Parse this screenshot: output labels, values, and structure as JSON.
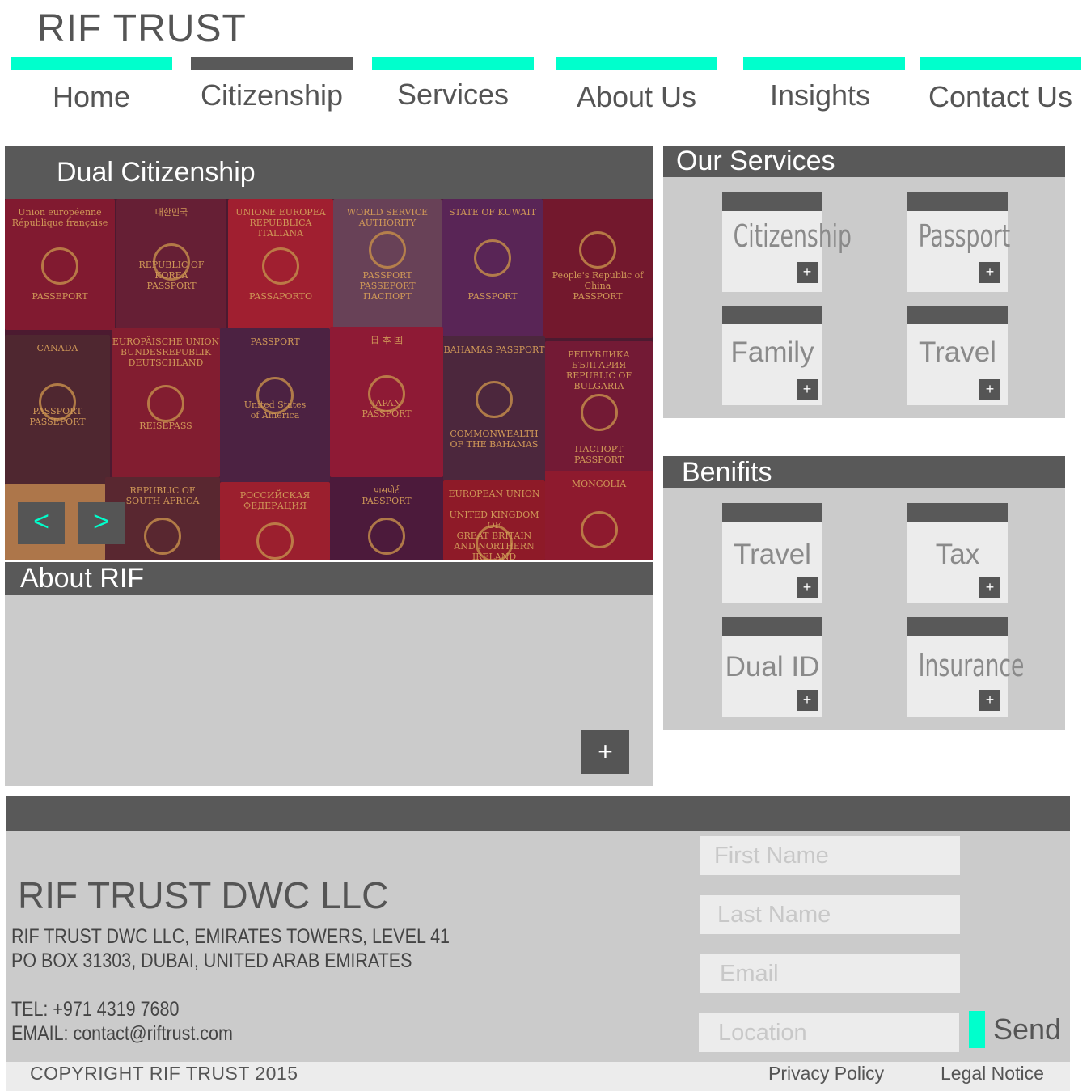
{
  "brand": {
    "logo": "RIF TRUST"
  },
  "colors": {
    "accent": "#00ffcc",
    "dark": "#595959",
    "panel": "#cbcbcb",
    "card": "#ececec"
  },
  "nav": {
    "items": [
      {
        "label": "Home",
        "active": false
      },
      {
        "label": "Citizenship",
        "active": true
      },
      {
        "label": "Services",
        "active": false
      },
      {
        "label": "About Us",
        "active": false
      },
      {
        "label": "Insights",
        "active": false
      },
      {
        "label": "Contact Us",
        "active": false
      }
    ]
  },
  "hero": {
    "title": "Dual Citizenship",
    "prev_label": "<",
    "next_label": ">",
    "passports": [
      {
        "lines": [
          "Union européenne",
          "République française",
          "",
          "",
          "",
          "",
          "",
          "",
          "PASSEPORT"
        ]
      },
      {
        "lines": [
          "대한민국",
          "",
          "",
          "",
          "",
          "REPUBLIC OF",
          "KOREA",
          "PASSPORT"
        ]
      },
      {
        "lines": [
          "UNIONE EUROPEA",
          "REPUBBLICA ITALIANA",
          "",
          "",
          "",
          "",
          "",
          "PASSAPORTO"
        ]
      },
      {
        "lines": [
          "WORLD SERVICE",
          "AUTHORITY",
          "",
          "",
          "",
          "",
          "PASSPORT",
          "PASSEPORT",
          "ПАСПОРТ"
        ]
      },
      {
        "lines": [
          "STATE OF KUWAIT",
          "",
          "",
          "",
          "",
          "",
          "",
          "",
          "PASSPORT"
        ]
      },
      {
        "lines": [
          "",
          "",
          "",
          "",
          "",
          "",
          "People's Republic of China",
          "PASSPORT"
        ]
      },
      {
        "lines": [
          "CANADA",
          "",
          "",
          "",
          "",
          "",
          "PASSPORT",
          "PASSEPORT"
        ]
      },
      {
        "lines": [
          "EUROPÄISCHE UNION",
          "BUNDESREPUBLIK",
          "DEUTSCHLAND",
          "",
          "",
          "",
          "",
          "",
          "REISEPASS"
        ]
      },
      {
        "lines": [
          "PASSPORT",
          "",
          "",
          "",
          "",
          "",
          "United States",
          "of America"
        ]
      },
      {
        "lines": [
          "日 本 国",
          "",
          "",
          "",
          "",
          "",
          "JAPAN",
          "PASSPORT"
        ]
      },
      {
        "lines": [
          "BAHAMAS PASSPORT",
          "",
          "",
          "",
          "",
          "",
          "",
          "",
          "COMMONWEALTH",
          "OF THE BAHAMAS"
        ]
      },
      {
        "lines": [
          "РЕПУБЛИКА",
          "БЪЛГАРИЯ",
          "REPUBLIC OF BULGARIA",
          "",
          "",
          "",
          "",
          "",
          "ПАСПОРТ",
          "PASSPORT"
        ]
      },
      {
        "lines": [
          "REPUBLIC OF",
          "SOUTH AFRICA"
        ]
      },
      {
        "lines": [
          "РОССИЙСКАЯ",
          "ФЕДЕРАЦИЯ"
        ]
      },
      {
        "lines": [
          "पासपोर्ट",
          "PASSPORT"
        ]
      },
      {
        "lines": [
          "EUROPEAN UNION",
          "",
          "UNITED KINGDOM OF",
          "GREAT BRITAIN",
          "AND NORTHERN IRELAND"
        ]
      },
      {
        "lines": [
          "MONGOLIA"
        ]
      }
    ]
  },
  "about": {
    "title": "About RIF",
    "more_label": "+"
  },
  "services": {
    "title": "Our Services",
    "cards": [
      {
        "label": "Citizenship",
        "plus": "+"
      },
      {
        "label": "Passport",
        "plus": "+"
      },
      {
        "label": "Family",
        "plus": "+"
      },
      {
        "label": "Travel",
        "plus": "+"
      }
    ]
  },
  "benefits": {
    "title": "Benifits",
    "cards": [
      {
        "label": "Travel",
        "plus": "+"
      },
      {
        "label": "Tax",
        "plus": "+"
      },
      {
        "label": "Dual ID",
        "plus": "+"
      },
      {
        "label": "Insurance",
        "plus": "+"
      }
    ]
  },
  "footer": {
    "company": "RIF TRUST DWC LLC",
    "address_line1": "RIF TRUST DWC LLC, EMIRATES TOWERS, LEVEL 41",
    "address_line2": "PO BOX 31303, DUBAI, UNITED ARAB EMIRATES",
    "tel": "TEL: +971 4319 7680",
    "email": "EMAIL: contact@riftrust.com",
    "form": {
      "first_name_placeholder": "First Name",
      "last_name_placeholder": "Last Name",
      "email_placeholder": "Email",
      "location_placeholder": "Location",
      "send_label": "Send"
    },
    "copyright": "COPYRIGHT RIF TRUST 2015",
    "privacy_label": "Privacy Policy",
    "legal_label": "Legal Notice"
  }
}
